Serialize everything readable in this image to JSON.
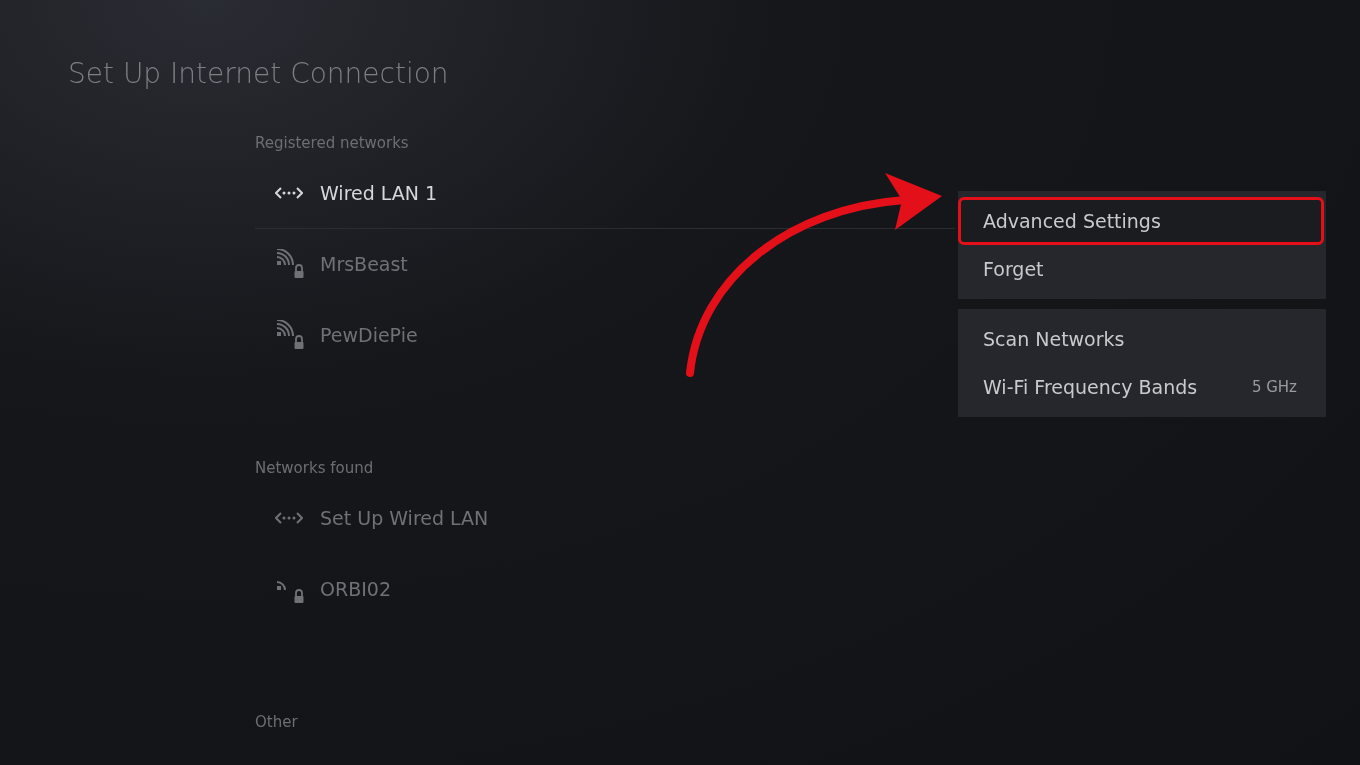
{
  "title": "Set Up Internet Connection",
  "sections": [
    {
      "label": "Registered networks",
      "items": [
        {
          "name": "Wired LAN 1",
          "kind": "wired",
          "selected": true
        },
        {
          "name": "MrsBeast",
          "kind": "wifi",
          "locked": true,
          "selected": false
        },
        {
          "name": "PewDiePie",
          "kind": "wifi",
          "locked": true,
          "selected": false
        }
      ]
    },
    {
      "label": "Networks found",
      "items": [
        {
          "name": "Set Up Wired LAN",
          "kind": "wired",
          "selected": false
        },
        {
          "name": "ORBI02",
          "kind": "wifi_weak",
          "locked": true,
          "selected": false
        }
      ]
    },
    {
      "label": "Other"
    }
  ],
  "menu_groups": [
    [
      {
        "label": "Advanced Settings",
        "highlighted": true
      },
      {
        "label": "Forget",
        "highlighted": false
      }
    ],
    [
      {
        "label": "Scan Networks",
        "highlighted": false
      },
      {
        "label": "Wi-Fi Frequency Bands",
        "value": "5 GHz",
        "highlighted": false
      }
    ]
  ]
}
